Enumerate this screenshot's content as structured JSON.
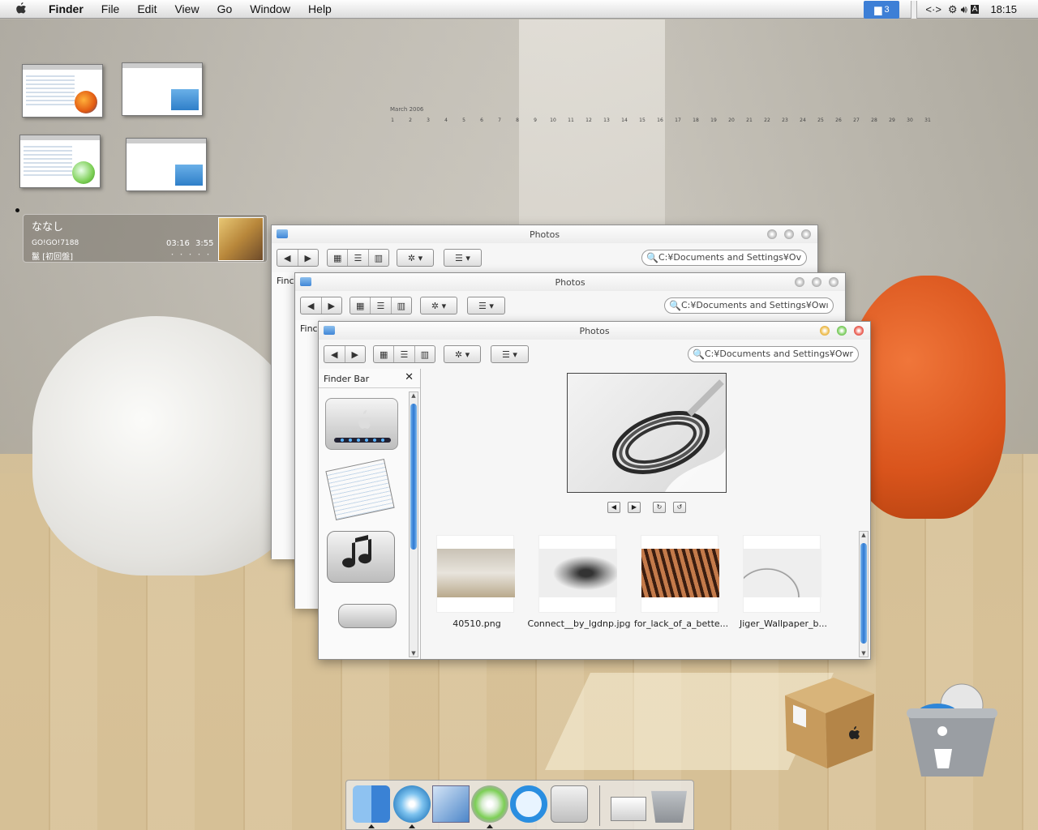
{
  "menubar": {
    "apple": "",
    "app_name": "Finder",
    "items": [
      "File",
      "Edit",
      "View",
      "Go",
      "Window",
      "Help"
    ],
    "spaces_badge": "3",
    "clock": "18:15"
  },
  "calendar": {
    "month": "March 2006",
    "days": [
      "1",
      "2",
      "3",
      "4",
      "5",
      "6",
      "7",
      "8",
      "9",
      "10",
      "11",
      "12",
      "13",
      "14",
      "15",
      "16",
      "17",
      "18",
      "19",
      "20",
      "21",
      "22",
      "23",
      "24",
      "25",
      "26",
      "27",
      "28",
      "29",
      "30",
      "31"
    ]
  },
  "music_widget": {
    "title": "ななし",
    "artist": "GO!GO!7188",
    "album": "鬣 [初回盤]",
    "elapsed": "03:16",
    "total": "3:55",
    "dots": "・・・・・"
  },
  "windows": {
    "back": {
      "title": "Photos",
      "search": "C:¥Documents and Settings¥Ov",
      "sidebar_label": "Finc"
    },
    "middle": {
      "title": "Photos",
      "search": "C:¥Documents and Settings¥Owı",
      "sidebar_label": "Finc"
    },
    "front": {
      "title": "Photos",
      "search": "C:¥Documents and Settings¥Owr",
      "sidebar_title": "Finder Bar",
      "sidebar_close": "✕",
      "files": [
        {
          "name": "40510.png"
        },
        {
          "name": "Connect__by_lgdnp.jpg"
        },
        {
          "name": "for_lack_of_a_bette..."
        },
        {
          "name": "Jiger_Wallpaper_b..."
        }
      ]
    }
  },
  "toolbar": {
    "back": "◀",
    "forward": "▶",
    "view_icon": "▦",
    "view_list": "☰",
    "view_column": "▥",
    "action": "✲ ▾",
    "arrange": "☰ ▾",
    "search_icon": "🔍"
  },
  "colors": {
    "accent": "#2e78d2",
    "desktop_floor": "#d7c197"
  }
}
